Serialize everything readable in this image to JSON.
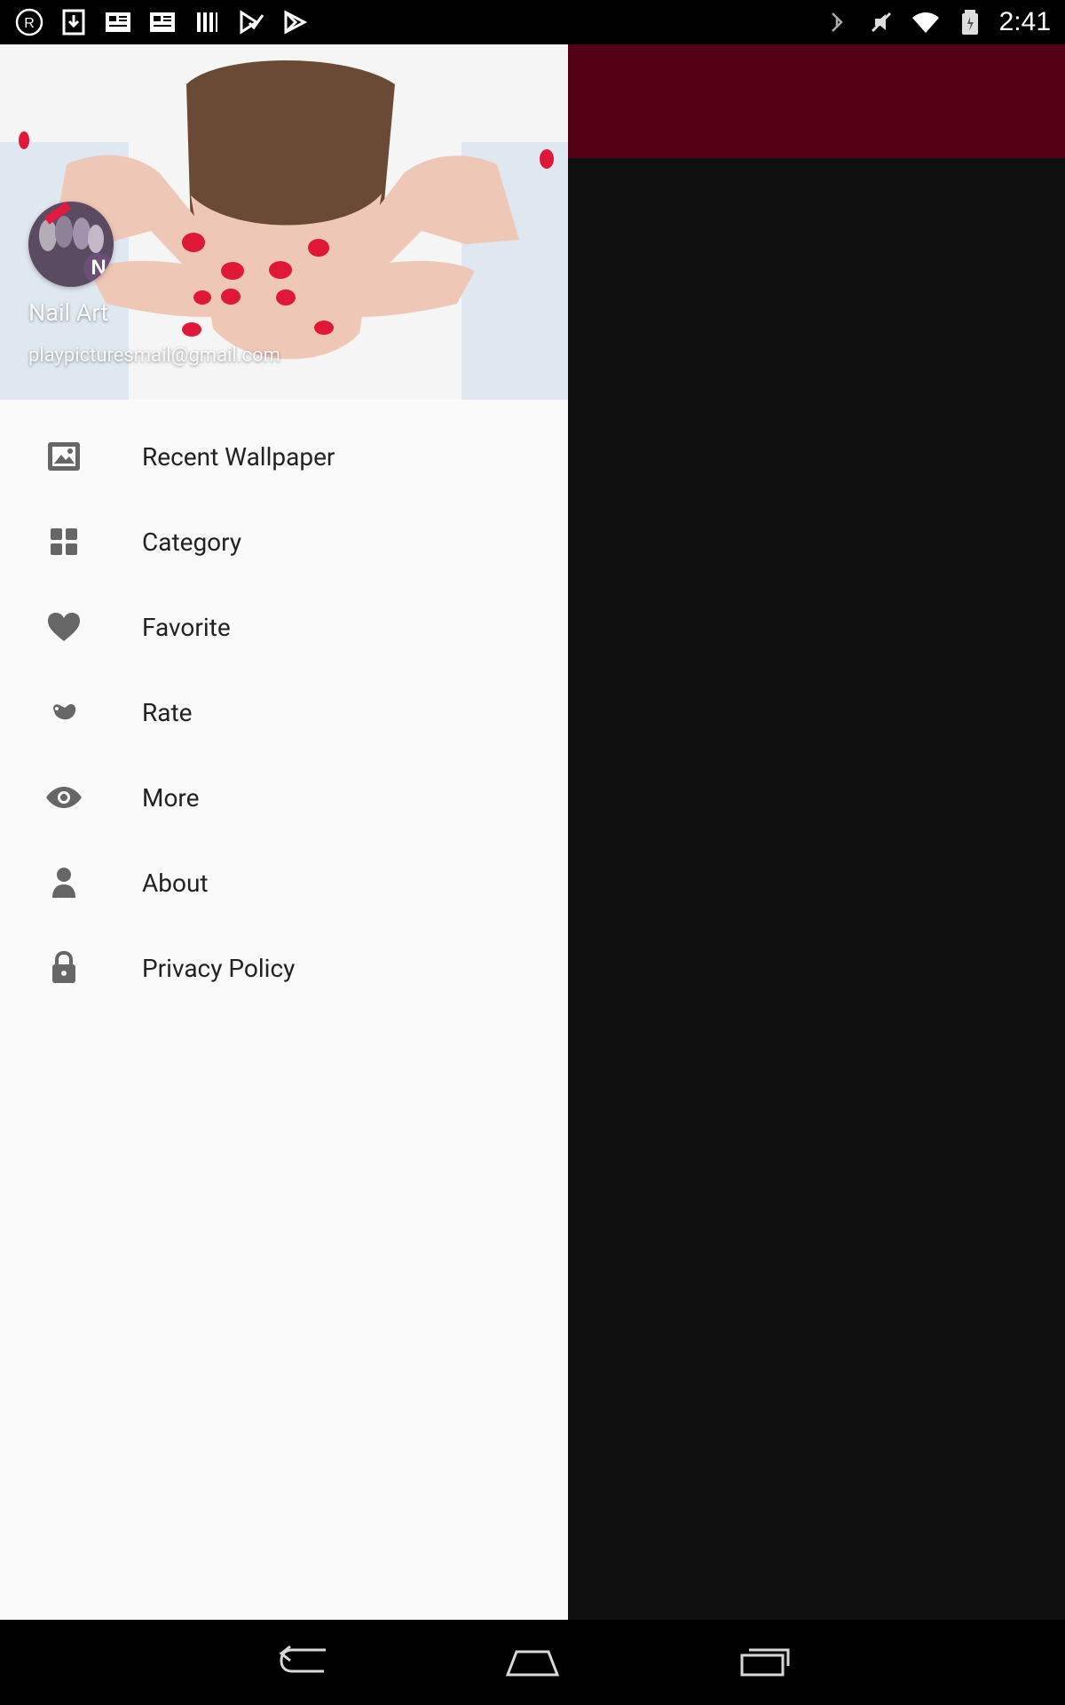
{
  "status_bar": {
    "time": "2:41"
  },
  "drawer": {
    "profile_name": "Nail Art",
    "profile_email": "playpicturesmail@gmail.com",
    "items": [
      {
        "label": "Recent Wallpaper",
        "icon": "image-icon"
      },
      {
        "label": "Category",
        "icon": "grid-icon"
      },
      {
        "label": "Favorite",
        "icon": "heart-icon"
      },
      {
        "label": "Rate",
        "icon": "rate-icon"
      },
      {
        "label": "More",
        "icon": "eye-icon"
      },
      {
        "label": "About",
        "icon": "person-icon"
      },
      {
        "label": "Privacy Policy",
        "icon": "lock-icon"
      }
    ]
  },
  "colors": {
    "appbar": "#540014",
    "scrim": "#101010",
    "drawer_bg": "#fafafa",
    "menu_text": "#222222",
    "icon": "#666666"
  }
}
